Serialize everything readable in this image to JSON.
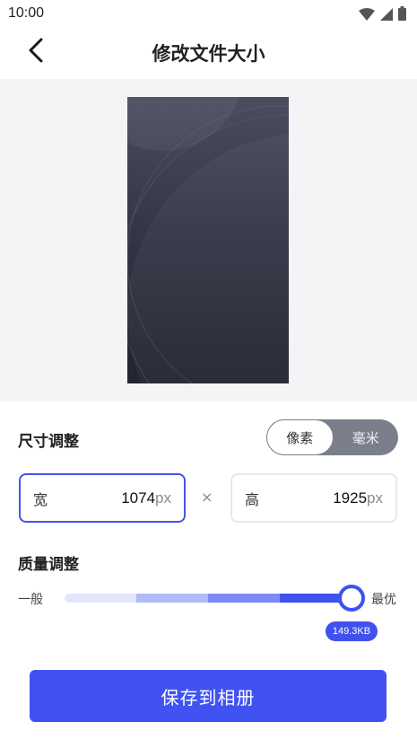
{
  "status_bar": {
    "time": "10:00",
    "icons": [
      "wifi-icon",
      "signal-icon",
      "battery-icon"
    ]
  },
  "header": {
    "back_icon": "chevron-left-icon",
    "title": "修改文件大小"
  },
  "size_section": {
    "title": "尺寸调整",
    "unit_options": [
      {
        "label": "像素",
        "selected": true
      },
      {
        "label": "毫米",
        "selected": false
      }
    ],
    "width": {
      "label": "宽",
      "value": "1074",
      "unit": "px"
    },
    "separator": "×",
    "height": {
      "label": "高",
      "value": "1925",
      "unit": "px"
    }
  },
  "quality_section": {
    "title": "质量调整",
    "min_label": "一般",
    "max_label": "最优",
    "level_fraction": 1.0,
    "file_size": "149.3KB"
  },
  "save_button": {
    "label": "保存到相册"
  },
  "colors": {
    "accent": "#3f51ee",
    "track_light": "#e3e6fb",
    "track_mid1": "#b2baf6",
    "track_mid2": "#7d8af2",
    "toggle_inactive": "#7b7f8c"
  }
}
